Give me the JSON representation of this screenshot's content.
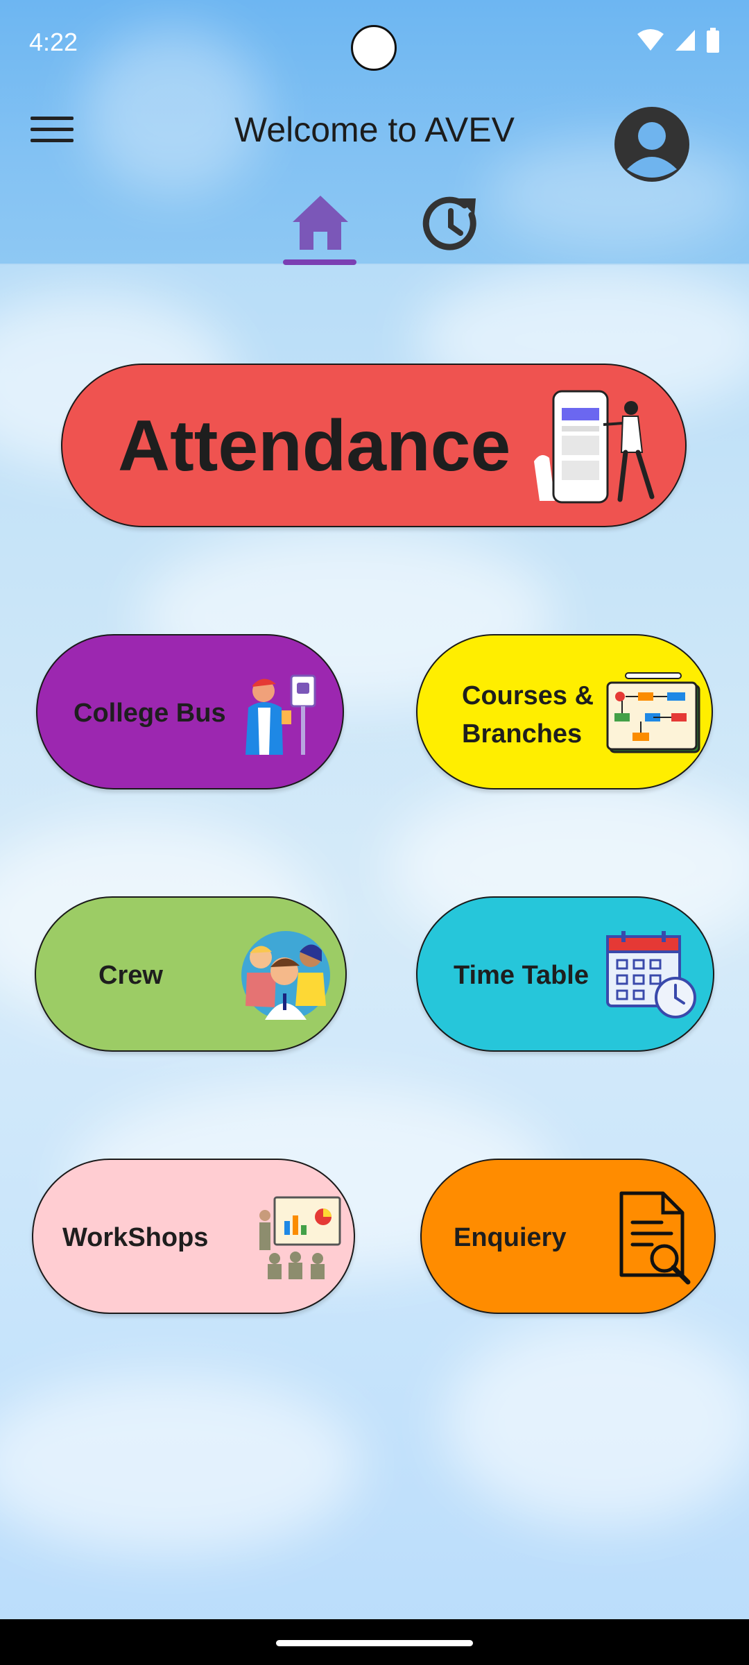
{
  "status_bar": {
    "time": "4:22"
  },
  "app_bar": {
    "title": "Welcome to AVEV"
  },
  "tabs": [
    {
      "name": "home",
      "icon": "home-icon",
      "selected": true
    },
    {
      "name": "history",
      "icon": "history-icon",
      "selected": false
    }
  ],
  "cards": {
    "attendance": {
      "label": "Attendance",
      "color": "#ef5350"
    },
    "college_bus": {
      "label": "College Bus",
      "color": "#9c27b0"
    },
    "courses": {
      "label_line1": "Courses &",
      "label_line2": "Branches",
      "color": "#ffee00"
    },
    "crew": {
      "label": "Crew",
      "color": "#9ccc65"
    },
    "time_table": {
      "label": "Time Table",
      "color": "#26c6da"
    },
    "workshops": {
      "label": "WorkShops",
      "color": "#ffcdd2"
    },
    "enquiry": {
      "label": "Enquiery",
      "color": "#ff8c00"
    }
  },
  "colors": {
    "tab_indicator": "#7b3fb3",
    "app_bar": "#6db6f2"
  }
}
